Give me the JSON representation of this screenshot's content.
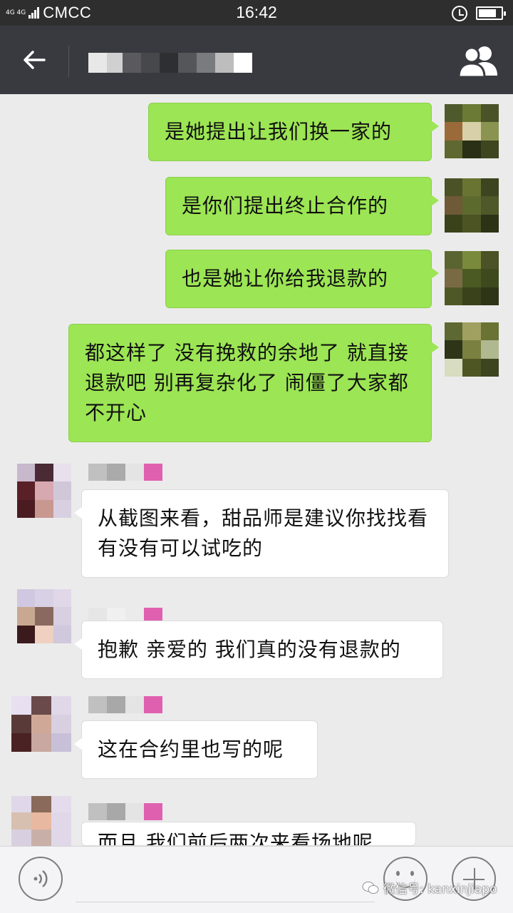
{
  "status_bar": {
    "network": "4G 4G",
    "carrier": "CMCC",
    "time": "16:42",
    "icons": [
      "signal-icon",
      "alarm-icon",
      "battery-icon"
    ]
  },
  "header": {
    "back_icon": "arrow-left-icon",
    "title": "",
    "group_icon": "group-members-icon"
  },
  "messages": [
    {
      "side": "out",
      "text": "是她提出让我们换一家的"
    },
    {
      "side": "out",
      "text": "是你们提出终止合作的"
    },
    {
      "side": "out",
      "text": "也是她让你给我退款的"
    },
    {
      "side": "out",
      "text": "都这样了 没有挽救的余地了 就直接退款吧 别再复杂化了 闹僵了大家都不开心"
    },
    {
      "side": "in",
      "text": "从截图来看，甜品师是建议你找找看有没有可以试吃的"
    },
    {
      "side": "in",
      "text": "抱歉 亲爱的 我们真的没有退款的"
    },
    {
      "side": "in",
      "text": "这在合约里也写的呢"
    },
    {
      "side": "in",
      "text": "而且 我们前后两次来看场地呢"
    }
  ],
  "input_bar": {
    "voice_icon": "voice-icon",
    "emoji_icon": "emoji-icon",
    "plus_icon": "plus-icon"
  },
  "watermark": "微信号: kanxinjiapo",
  "colors": {
    "status_bar": "#2e2e2e",
    "header": "#393a3f",
    "background": "#ebebeb",
    "outgoing_bubble": "#9ce554",
    "incoming_bubble": "#ffffff"
  }
}
